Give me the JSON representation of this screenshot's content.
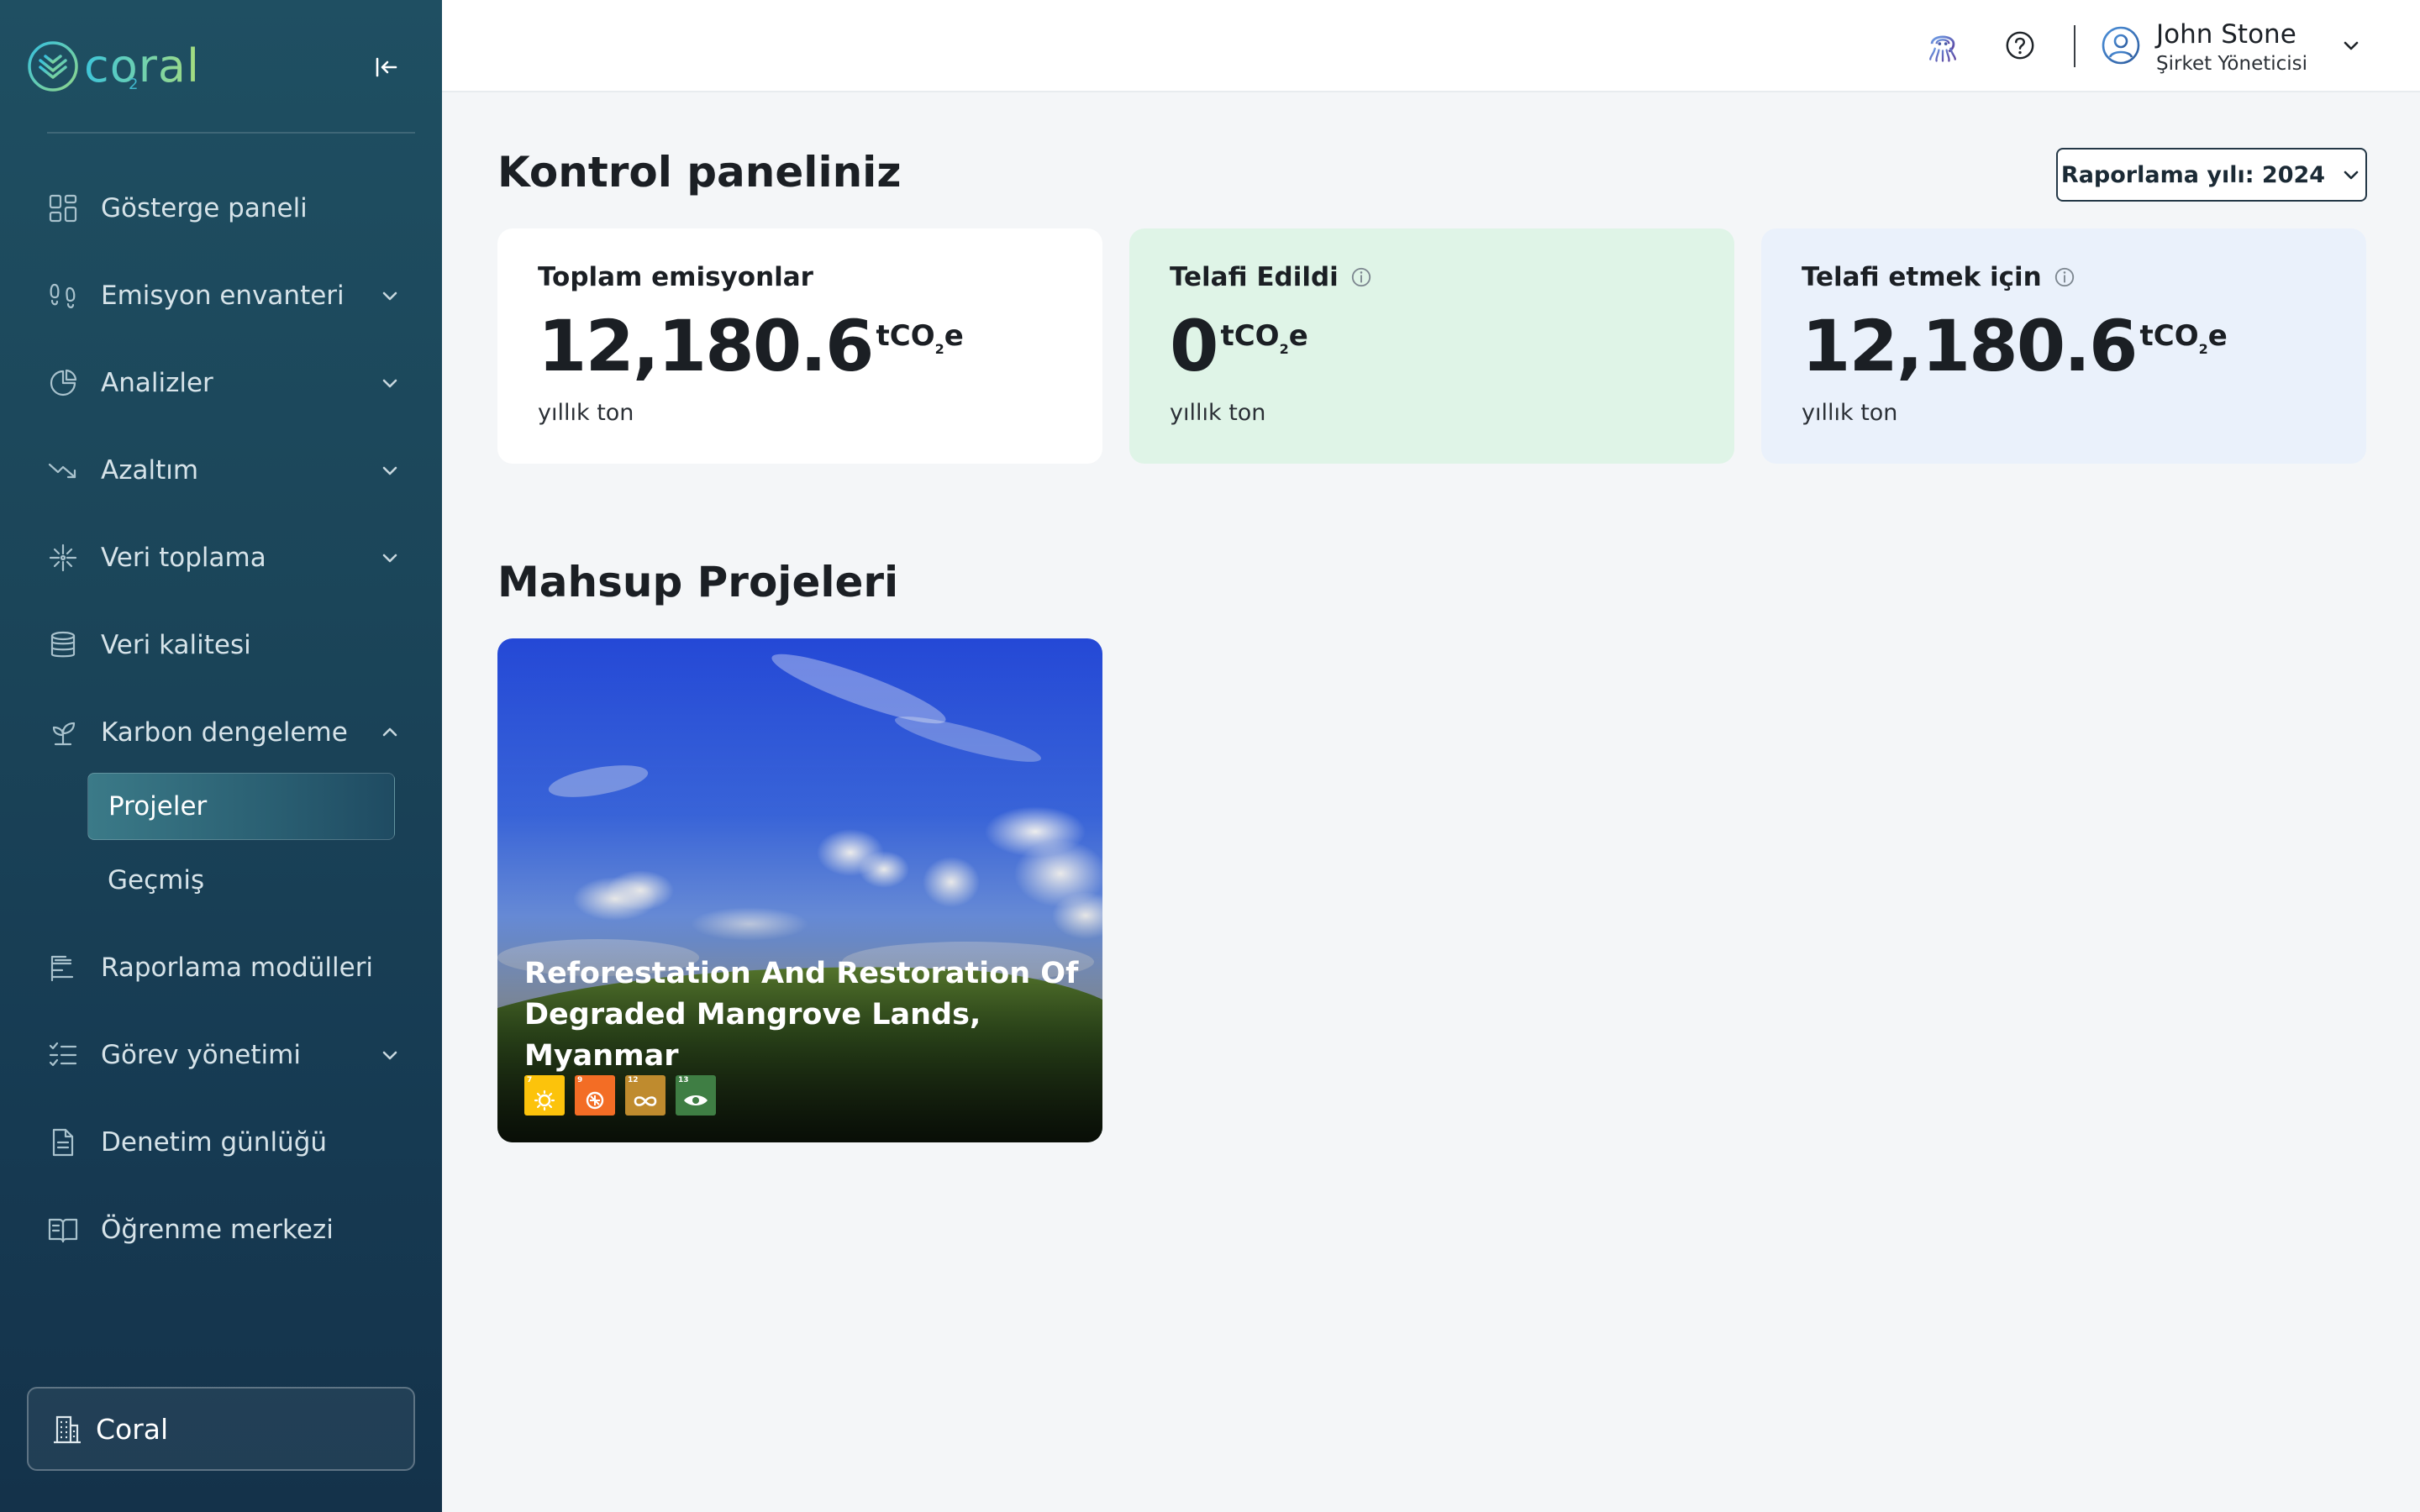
{
  "app": {
    "logo_text": "coral",
    "logo_sub": "2"
  },
  "sidebar": {
    "items": [
      {
        "label": "Gösterge paneli",
        "icon": "grid-icon"
      },
      {
        "label": "Emisyon envanteri",
        "icon": "footprint-icon"
      },
      {
        "label": "Analizler",
        "icon": "pie-chart-icon"
      },
      {
        "label": "Azaltım",
        "icon": "trend-down-icon"
      },
      {
        "label": "Veri toplama",
        "icon": "sparkle-icon"
      },
      {
        "label": "Veri kalitesi",
        "icon": "database-icon"
      },
      {
        "label": "Karbon dengeleme",
        "icon": "sprout-icon"
      },
      {
        "label": "Raporlama modülleri",
        "icon": "report-icon"
      },
      {
        "label": "Görev yönetimi",
        "icon": "task-list-icon"
      },
      {
        "label": "Denetim günlüğü",
        "icon": "document-icon"
      },
      {
        "label": "Öğrenme merkezi",
        "icon": "book-icon"
      }
    ],
    "subitems": [
      {
        "label": "Projeler",
        "active": true
      },
      {
        "label": "Geçmiş",
        "active": false
      }
    ],
    "org": {
      "label": "Coral",
      "icon": "building-icon"
    }
  },
  "header": {
    "user": {
      "name": "John Stone",
      "role": "Şirket Yöneticisi"
    }
  },
  "main": {
    "title": "Kontrol paneliniz",
    "year_select": "Raporlama yılı: 2024",
    "cards": [
      {
        "title": "Toplam emisyonlar",
        "value": "12,180.6",
        "unit_prefix": "tCO",
        "unit_sub": "2",
        "unit_suffix": "e",
        "period": "yıllık ton"
      },
      {
        "title": "Telafi Edildi",
        "value": "0",
        "unit_prefix": "tCO",
        "unit_sub": "2",
        "unit_suffix": "e",
        "period": "yıllık ton"
      },
      {
        "title": "Telafi etmek için",
        "value": "12,180.6",
        "unit_prefix": "tCO",
        "unit_sub": "2",
        "unit_suffix": "e",
        "period": "yıllık ton"
      }
    ],
    "section_title": "Mahsup Projeleri",
    "projects": [
      {
        "title": "Reforestation And Restoration Of Degraded Mangrove Lands, Myanmar",
        "sdgs": [
          {
            "number": "7",
            "color": "#fcc30b",
            "icon": "sun-icon"
          },
          {
            "number": "9",
            "color": "#f36d25",
            "icon": "industry-icon"
          },
          {
            "number": "12",
            "color": "#bf8b2e",
            "icon": "infinity-icon"
          },
          {
            "number": "13",
            "color": "#3f7e44",
            "icon": "eye-icon"
          }
        ]
      }
    ]
  },
  "colors": {
    "sidebar_top": "#1f4f62",
    "sidebar_bottom": "#14324a",
    "card_offset": "#dff4e7",
    "card_to_offset": "#eaf1fb",
    "accent": "#3fb7cc"
  }
}
